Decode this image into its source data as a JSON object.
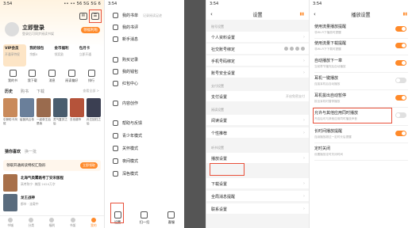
{
  "s1": {
    "status_time": "3:54",
    "status_right": "•• •• 56 5G 5G 6",
    "login": "立即登录",
    "login_sub": "登录后可同步阅读书架",
    "pill": "领福利啦",
    "vip": [
      {
        "t": "VIP会员",
        "s": "开通享特权"
      },
      {
        "t": "我的钱包",
        "s": "余额0"
      },
      {
        "t": "金币福利",
        "s": "领奖励"
      },
      {
        "t": "包月卡",
        "s": "立即开通"
      }
    ],
    "grid": [
      "我的书",
      "我下载",
      "消息",
      "阅读偏好",
      "排行"
    ],
    "tabs": [
      "历史",
      "购书",
      "下载"
    ],
    "allrec": "查看全部 >",
    "books": [
      {
        "t": "引骄彩卡凤班",
        "c": "#c98a5a"
      },
      {
        "t": "疫医风云传",
        "c": "#6a7f9a"
      },
      {
        "t": "一武帝王后是我",
        "c": "#9a6b4e"
      },
      {
        "t": "灵气复苏之后",
        "c": "#4a5d6e"
      },
      {
        "t": "去世超市",
        "c": "#b5533a"
      },
      {
        "t": "孙王回归之后",
        "c": "#3b3f52"
      }
    ],
    "guess_title": "猜你喜欢",
    "guess_alt": "换一批",
    "banner": "领取开通阅读特权汇隐形",
    "banner_btn": "立即领取",
    "rec": [
      {
        "t": "北海气类雾路考丁安宋版程",
        "s": "高考陈宁· 美图 2424万字",
        "c": "#a8704a"
      },
      {
        "t": "龙王战神",
        "s": "都市 · 连载中",
        "c": "#596b7d"
      },
      {
        "t": "龙王云步 & 爱情美歌",
        "s": "月牙足钱 · 完结",
        "c": "#c17a59"
      }
    ],
    "nav": [
      "书城",
      "分类",
      "福利",
      "书架",
      "我的"
    ]
  },
  "s2": {
    "status_time": "3:54",
    "items": [
      {
        "t": "我的书单",
        "d": "记录阅读足迹"
      },
      {
        "t": "我的书评",
        "d": ""
      },
      {
        "t": "新手消息",
        "d": ""
      },
      {
        "t": "购买记录",
        "d": ""
      },
      {
        "t": "我的钱包",
        "d": ""
      },
      {
        "t": "红包中心",
        "d": ""
      },
      {
        "t": "内容创作",
        "d": ""
      },
      {
        "t": "帮助与反馈",
        "d": ""
      },
      {
        "t": "青少年模式",
        "d": ""
      },
      {
        "t": "关怀模式",
        "d": ""
      },
      {
        "t": "夜间模式",
        "d": ""
      },
      {
        "t": "深色模式",
        "d": ""
      }
    ],
    "bottom": [
      "设置",
      "扫一扫",
      "客服"
    ]
  },
  "s3": {
    "status_time": "3:54",
    "title": "设置",
    "sec_account": "账号设置",
    "account": [
      "个人资料设置",
      "社交账号绑定",
      "手机号码绑定",
      "账号安全设置"
    ],
    "sec_pay": "支付设置",
    "pay": "支付设置",
    "pay_val": "开启免密支付",
    "sec_read": "阅读设置",
    "read": [
      "阅读设置",
      "个性推荐"
    ],
    "sec_play": "听书设置",
    "play": "播放设置",
    "others": [
      "下载设置",
      "全局消息提醒",
      "联系设置"
    ]
  },
  "s4": {
    "status_time": "3:54",
    "title": "播放设置",
    "items": [
      {
        "t": "使用流量播放提醒",
        "d": "非Wi-Fi下播放时提醒",
        "on": true
      },
      {
        "t": "使用流量下载提醒",
        "d": "非Wi-Fi下下载时提醒",
        "on": true
      },
      {
        "t": "自动播放下一章",
        "d": "当前章节播完后自动播放",
        "on": true
      },
      {
        "t": "耳机一键播放",
        "d": "连接耳机后自动播放",
        "on": false
      },
      {
        "t": "耳机拔出自动暂停",
        "d": "拔出耳机时暂停播放",
        "on": true
      },
      {
        "t": "允许与其他应用同时播放",
        "d": "开启后可与其他应用同时播放声音",
        "on": false
      },
      {
        "t": "长时间播放提醒",
        "d": "连续播放超过一定时长后提醒",
        "on": true
      },
      {
        "t": "定时关闭",
        "d": "设置播放定时关闭时间",
        "on": null
      }
    ]
  }
}
